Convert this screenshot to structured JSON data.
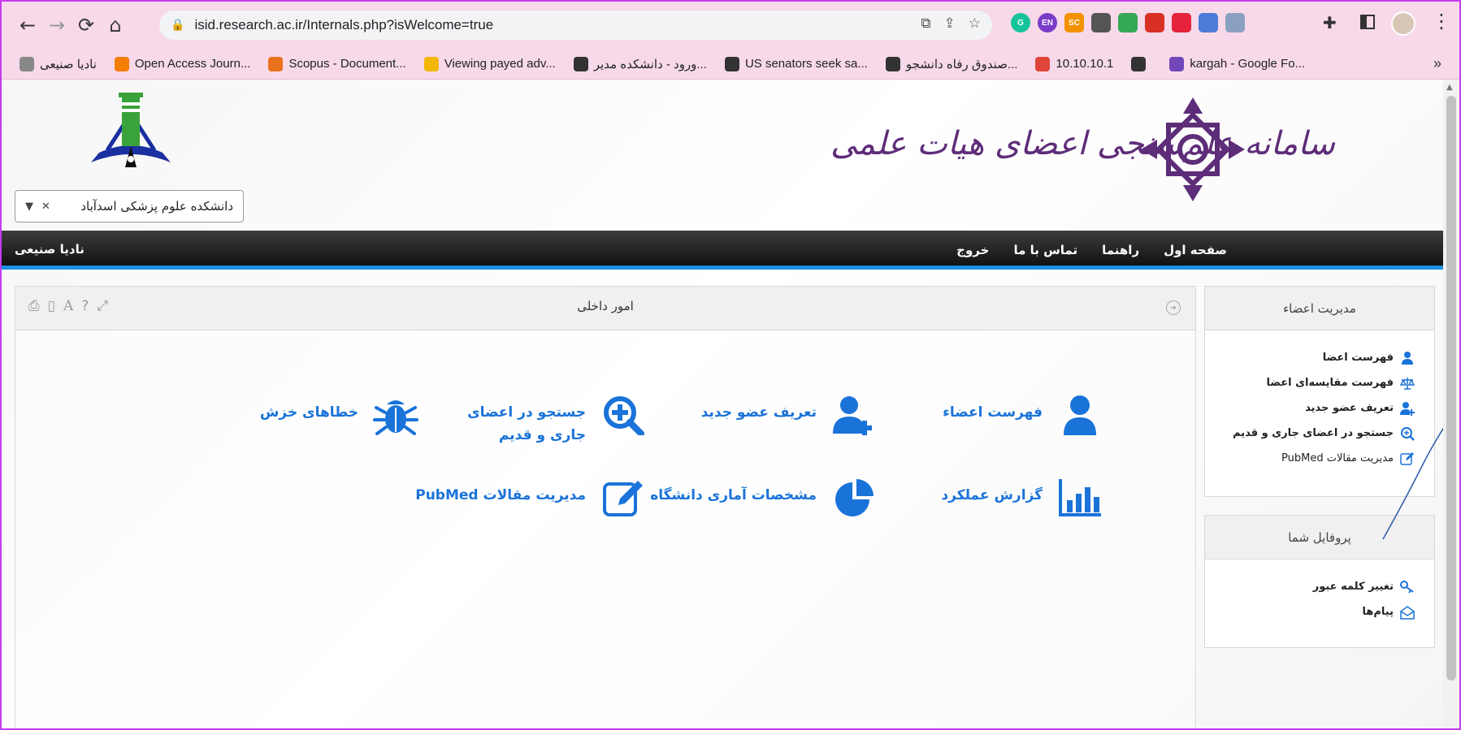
{
  "browser": {
    "url": "isid.research.ac.ir/Internals.php?isWelcome=true",
    "extensions": [
      {
        "name": "grammarly-ext",
        "label": "G",
        "color": "#15c39a"
      },
      {
        "name": "translate-ext",
        "label": "EN",
        "color": "#7a3cc8"
      },
      {
        "name": "sc-ext",
        "label": "SC",
        "color": "#f39200"
      },
      {
        "name": "maps-pin-ext",
        "label": "",
        "color": "#555555"
      },
      {
        "name": "maps-ext",
        "label": "",
        "color": "#34a853"
      },
      {
        "name": "pin-red-ext",
        "label": "",
        "color": "#d93025"
      },
      {
        "name": "red-grid-ext",
        "label": "",
        "color": "#e5243b"
      },
      {
        "name": "blue-ext",
        "label": "",
        "color": "#4b7bd6"
      },
      {
        "name": "shield-ext",
        "label": "",
        "color": "#8aa0c0"
      }
    ]
  },
  "bookmarks": [
    {
      "label": "نادیا صنیعی",
      "icon": "nadia-icon",
      "color": "#888888"
    },
    {
      "label": "Open Access Journ...",
      "icon": "blogger-icon",
      "color": "#f57d00"
    },
    {
      "label": "Scopus - Document...",
      "icon": "scopus-icon",
      "color": "#e9711c"
    },
    {
      "label": "Viewing payed adv...",
      "icon": "coin-icon",
      "color": "#f2b705"
    },
    {
      "label": "ورود - دانشکده مدیر...",
      "icon": "globe-icon",
      "color": "#333333"
    },
    {
      "label": "US senators seek sa...",
      "icon": "globe-icon",
      "color": "#333333"
    },
    {
      "label": "صندوق رفاه دانشجو...",
      "icon": "globe-icon",
      "color": "#333333"
    },
    {
      "label": "10.10.10.1",
      "icon": "router-icon",
      "color": "#e0453a"
    },
    {
      "label": "",
      "icon": "globe-icon",
      "color": "#333333"
    },
    {
      "label": "kargah - Google Fo...",
      "icon": "forms-icon",
      "color": "#7248b9"
    }
  ],
  "header": {
    "site_title": "سامانه علم‌سنجی اعضای هیات علمی",
    "university": "دانشکده علوم پزشکی اسدآباد"
  },
  "menu": {
    "items": [
      "صفحه اول",
      "راهنما",
      "تماس با ما",
      "خروج"
    ],
    "username": "نادیا صنیعی"
  },
  "panel": {
    "title": "امور داخلی",
    "tiles": [
      {
        "label": "فهرست اعضاء",
        "icon": "user-icon"
      },
      {
        "label": "تعریف عضو جدید",
        "icon": "user-plus-icon"
      },
      {
        "label": "جستجو در اعضای جاری و قدیم",
        "icon": "search-plus-icon"
      },
      {
        "label": "خطاهای خزش",
        "icon": "bug-icon"
      },
      {
        "label": "گزارش عملکرد",
        "icon": "bar-chart-icon"
      },
      {
        "label": "مشخصات آماری دانشگاه",
        "icon": "pie-chart-icon"
      },
      {
        "label": "مدیریت مقالات PubMed",
        "icon": "edit-icon"
      }
    ]
  },
  "sidebar": {
    "members": {
      "title": "مدیریت اعضاء",
      "items": [
        "فهرست اعضا",
        "فهرست مقایسه‌ای اعضا",
        "تعریف عضو جدید",
        "جستجو در اعضای جاری و قدیم",
        "مدیریت مقالات PubMed"
      ]
    },
    "profile": {
      "title": "پروفایل شما",
      "items": [
        "تغییر کلمه عبور",
        "پیام‌ها"
      ]
    }
  },
  "colors": {
    "accent": "#1a73d9",
    "brand": "#5e2d79",
    "menu_bar": "#1c1c1c",
    "menu_border": "#1d8fe0",
    "chrome": "#f7d9ea"
  }
}
